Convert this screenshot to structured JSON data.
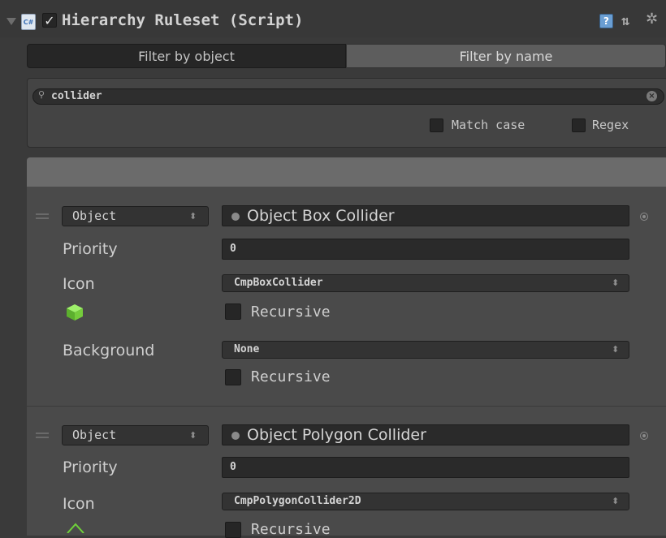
{
  "component": {
    "title": "Hierarchy Ruleset (Script)",
    "enabled": true,
    "icon": "csharp-script-icon"
  },
  "header_icons": [
    "help-icon",
    "preset-icon",
    "gear-icon"
  ],
  "tabs": [
    {
      "label": "Filter by object",
      "selected": true
    },
    {
      "label": "Filter by name",
      "selected": false
    }
  ],
  "search": {
    "value": "collider"
  },
  "options": {
    "match_case": {
      "label": "Match case",
      "checked": false
    },
    "regex": {
      "label": "Regex",
      "checked": false
    }
  },
  "rules": [
    {
      "type": "Object",
      "object": "Object Box Collider",
      "priority_label": "Priority",
      "priority": "0",
      "icon_label": "Icon",
      "icon_value": "CmpBoxCollider",
      "icon_preview": "box-collider-icon",
      "icon_recursive_label": "Recursive",
      "background_label": "Background",
      "background_value": "None",
      "background_recursive_label": "Recursive"
    },
    {
      "type": "Object",
      "object": "Object Polygon Collider",
      "priority_label": "Priority",
      "priority": "0",
      "icon_label": "Icon",
      "icon_value": "CmpPolygonCollider2D",
      "icon_preview": "polygon-collider-icon",
      "icon_recursive_label": "Recursive"
    }
  ],
  "colors": {
    "panel_bg": "#3a3a3a",
    "list_bg": "#4a4a4a",
    "list_header": "#6b6b6b",
    "field_bg": "#2a2a2a",
    "accent_green": "#6fd13a"
  }
}
